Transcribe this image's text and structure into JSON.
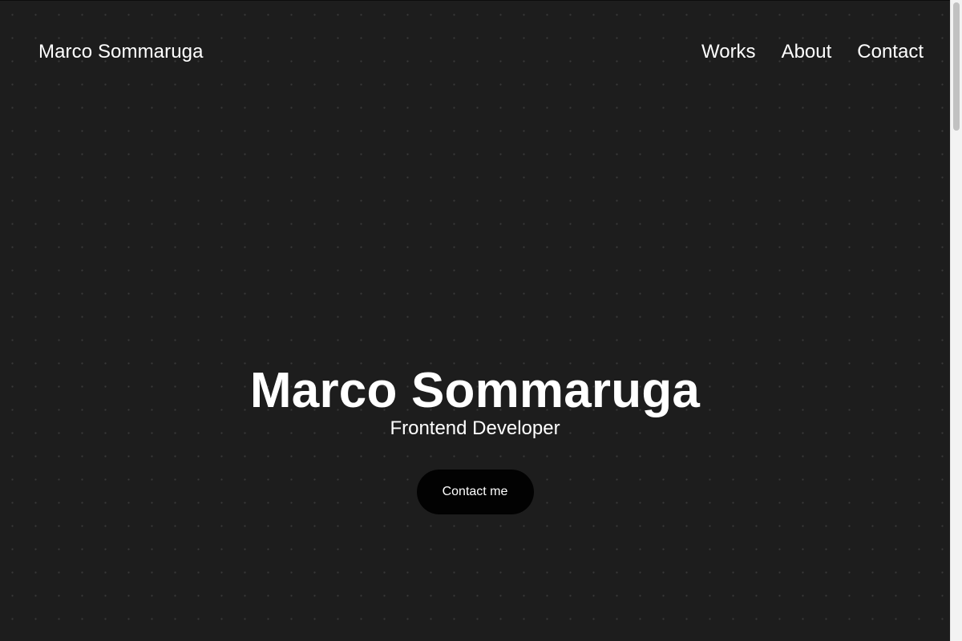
{
  "header": {
    "brand": "Marco Sommaruga",
    "nav": [
      {
        "label": "Works"
      },
      {
        "label": "About"
      },
      {
        "label": "Contact"
      }
    ]
  },
  "hero": {
    "title": "Marco Sommaruga",
    "subtitle": "Frontend Developer",
    "cta_label": "Contact me"
  },
  "colors": {
    "background": "#1d1d1d",
    "text": "#ffffff",
    "button": "#020202",
    "dot_grid": "#3a3a3a"
  },
  "scroll": {
    "position": 0
  }
}
